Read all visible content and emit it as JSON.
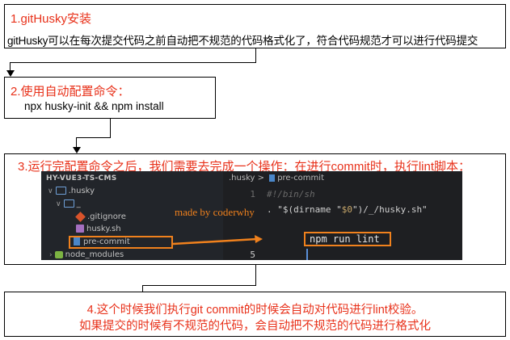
{
  "step1": {
    "title": "1.gitHusky安装",
    "desc": "gitHusky可以在每次提交代码之前自动把不规范的代码格式化了，符合代码规范才可以进行代码提交"
  },
  "step2": {
    "title": "2.使用自动配置命令：",
    "cmd": "npx husky-init && npm install"
  },
  "step3": {
    "title": "3.运行完配置命令之后，我们需要去完成一个操作：在进行commit时，执行lint脚本：",
    "explorer": {
      "header": "HY-VUE3-TS-CMS",
      "husky_folder": ".husky",
      "underscore_folder": "_",
      "gitignore": ".gitignore",
      "husky_sh": "husky.sh",
      "pre_commit": "pre-commit",
      "node_modules": "node_modules"
    },
    "code": {
      "crumb_folder": ".husky",
      "crumb_sep": ">",
      "crumb_file": "pre-commit",
      "line1_no": "1",
      "line1": "#!/bin/sh",
      "line2_a": ". \"$(dirname \"",
      "line2_var": "$0",
      "line2_b": "\")/_/husky.sh\"",
      "line4_cmd": "npm run lint",
      "line5_no": "5"
    },
    "watermark": "made by coderwhy"
  },
  "step4": {
    "line1": "4.这个时候我们执行git commit的时候会自动对代码进行lint校验。",
    "line2": "如果提交的时候有不规范的代码，会自动把不规范的代码进行格式化"
  },
  "colors": {
    "red_text": "#e8311a",
    "orange_highlight": "#f0811d"
  }
}
